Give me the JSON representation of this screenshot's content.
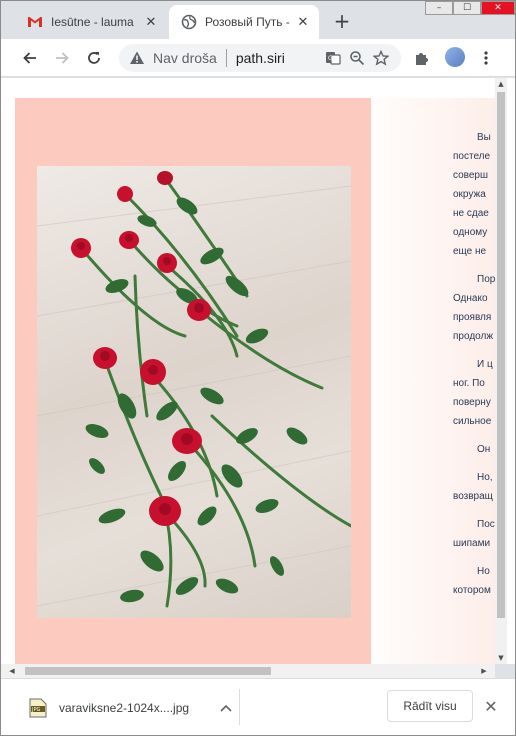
{
  "browser": {
    "tabs": [
      {
        "title": "Iesūtne - lauma",
        "icon": "gmail-icon",
        "active": false
      },
      {
        "title": "Розовый Путь - ",
        "icon": "globe-icon",
        "active": true
      }
    ],
    "new_tab_label": "+",
    "window_controls": {
      "minimize": "–",
      "maximize": "☐",
      "close": "✕"
    }
  },
  "toolbar": {
    "back_icon": "←",
    "forward_icon": "→",
    "reload_icon": "⟳",
    "security_label": "Nav droša",
    "url": "path.siri",
    "accent_color": "#1a73e8"
  },
  "page": {
    "background_color": "#fccabe",
    "photo_subject": "red roses on wooden floor",
    "article_lines": [
      [
        "Вы",
        "постеле",
        "соверш",
        "окружа",
        "не сдае",
        "одному",
        "еще не"
      ],
      [
        "Пор",
        "Однако",
        "проявля",
        "продолж"
      ],
      [
        "И ц",
        "ног.  По",
        "поверну",
        "сильное"
      ],
      [
        "Он"
      ],
      [
        "Но,",
        "возвращ"
      ],
      [
        "Пос",
        "шипами"
      ],
      [
        "Но",
        "котором"
      ]
    ]
  },
  "downloads": {
    "file_name": "varaviksne2-1024x....jpg",
    "file_icon": "jpg-file-icon",
    "show_all_label": "Rādīt visu",
    "close_icon": "✕"
  }
}
